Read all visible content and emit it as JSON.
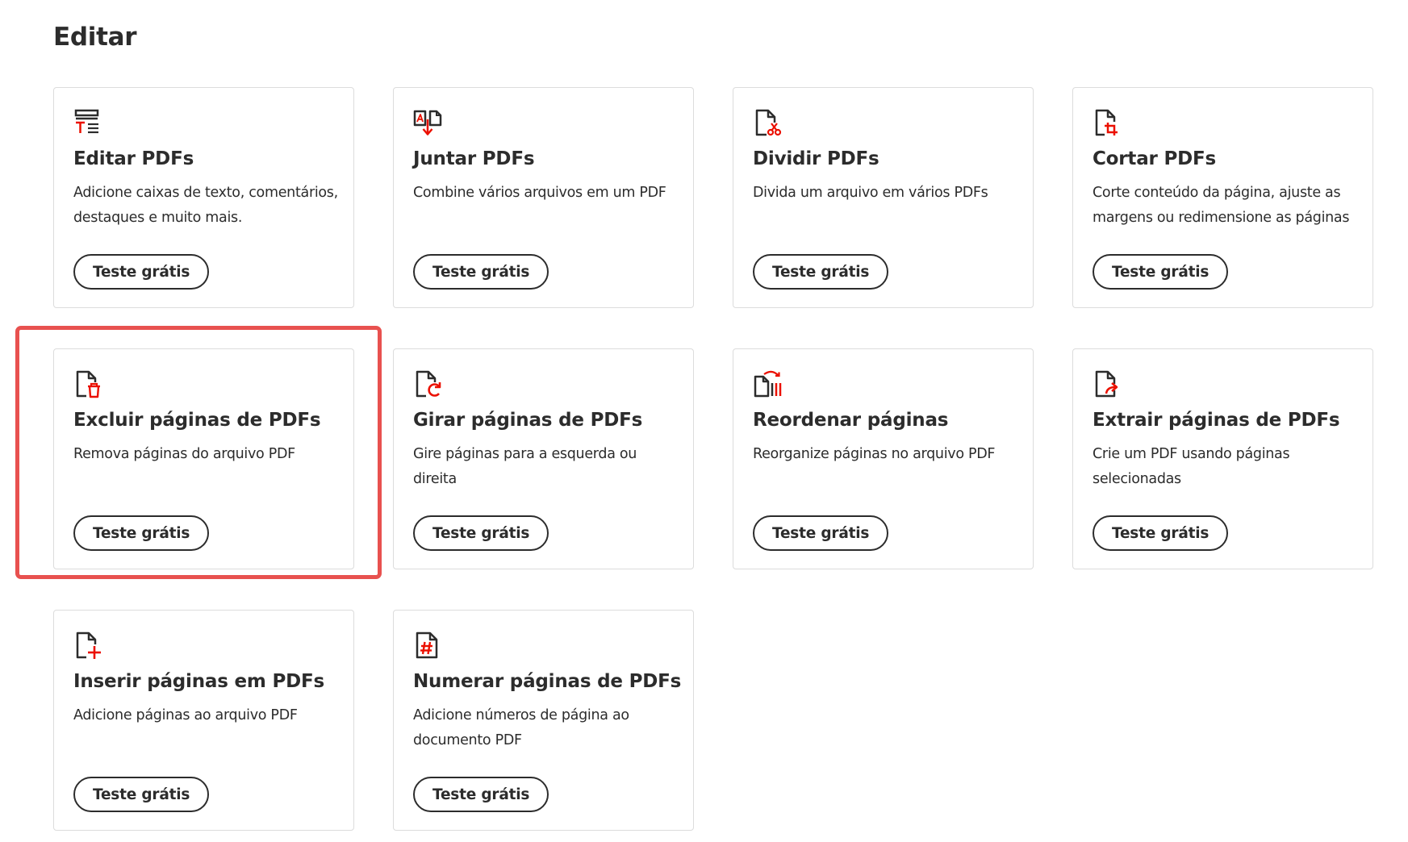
{
  "section": {
    "title": "Editar"
  },
  "colors": {
    "accent": "#eb1000",
    "text": "#2c2c2c",
    "highlight": "#e8514f",
    "card_border": "#dcdcdc"
  },
  "cards": [
    {
      "icon": "edit-pdf-icon",
      "title": "Editar PDFs",
      "description": "Adicione caixas de texto, comentários, destaques e muito mais.",
      "cta": "Teste grátis"
    },
    {
      "icon": "combine-pdf-icon",
      "title": "Juntar PDFs",
      "description": "Combine vários arquivos em um PDF",
      "cta": "Teste grátis"
    },
    {
      "icon": "split-pdf-icon",
      "title": "Dividir PDFs",
      "description": "Divida um arquivo em vários PDFs",
      "cta": "Teste grátis"
    },
    {
      "icon": "crop-pdf-icon",
      "title": "Cortar PDFs",
      "description": "Corte conteúdo da página, ajuste as margens ou redimensione as páginas",
      "cta": "Teste grátis"
    },
    {
      "icon": "delete-pages-icon",
      "title": "Excluir páginas de PDFs",
      "description": "Remova páginas do arquivo PDF",
      "cta": "Teste grátis",
      "highlighted": true
    },
    {
      "icon": "rotate-pages-icon",
      "title": "Girar páginas de PDFs",
      "description": "Gire páginas para a esquerda ou direita",
      "cta": "Teste grátis"
    },
    {
      "icon": "reorder-pages-icon",
      "title": "Reordenar páginas",
      "description": "Reorganize páginas no arquivo PDF",
      "cta": "Teste grátis"
    },
    {
      "icon": "extract-pages-icon",
      "title": "Extrair páginas de PDFs",
      "description": "Crie um PDF usando páginas selecionadas",
      "cta": "Teste grátis"
    },
    {
      "icon": "insert-pages-icon",
      "title": "Inserir páginas em PDFs",
      "description": "Adicione páginas ao arquivo PDF",
      "cta": "Teste grátis"
    },
    {
      "icon": "number-pages-icon",
      "title": "Numerar páginas de PDFs",
      "description": "Adicione números de página ao documento PDF",
      "cta": "Teste grátis"
    }
  ]
}
